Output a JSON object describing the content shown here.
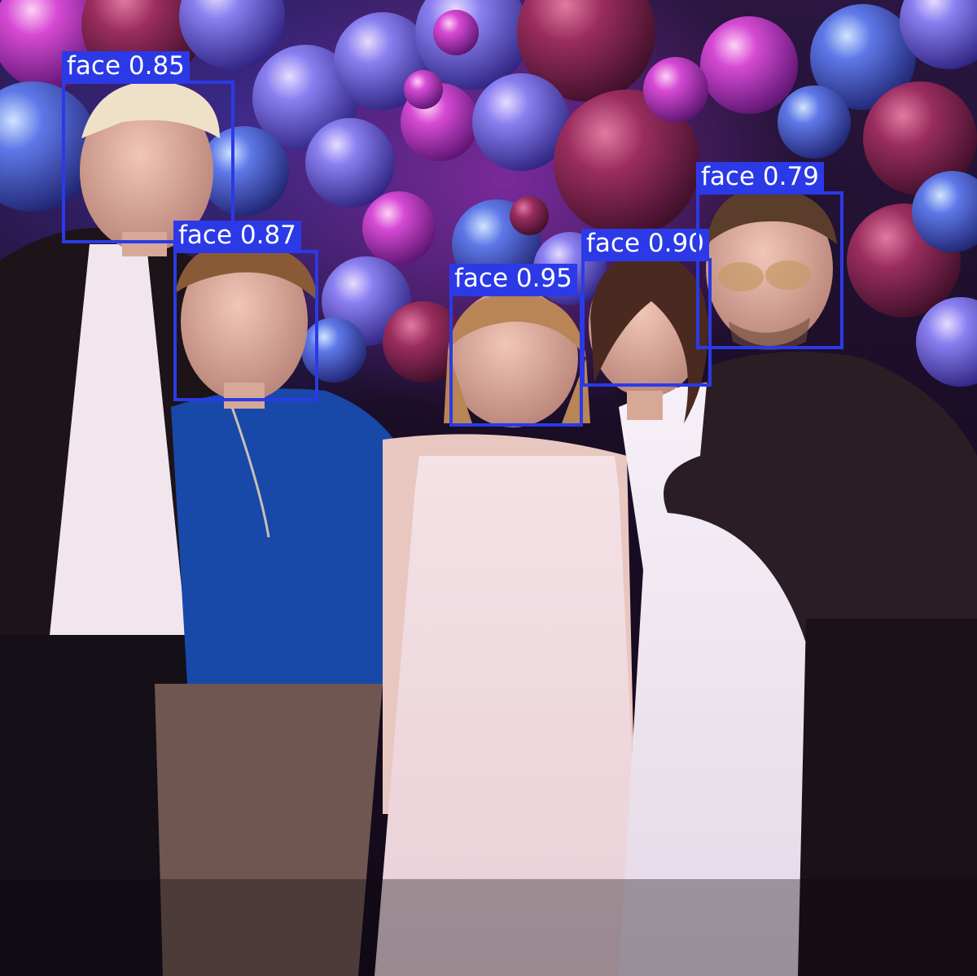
{
  "palette": {
    "box_color": "#2b3ae6",
    "label_text_color": "#ffffff",
    "balloon_violet": "#6a5ee0",
    "balloon_magenta": "#c03cc0",
    "balloon_burgundy": "#8a2650"
  },
  "detections": [
    {
      "label": "face",
      "score": "0.85",
      "text": "face 0.85"
    },
    {
      "label": "face",
      "score": "0.87",
      "text": "face 0.87"
    },
    {
      "label": "face",
      "score": "0.95",
      "text": "face 0.95"
    },
    {
      "label": "face",
      "score": "0.90",
      "text": "face 0.90"
    },
    {
      "label": "face",
      "score": "0.79",
      "text": "face 0.79"
    }
  ]
}
